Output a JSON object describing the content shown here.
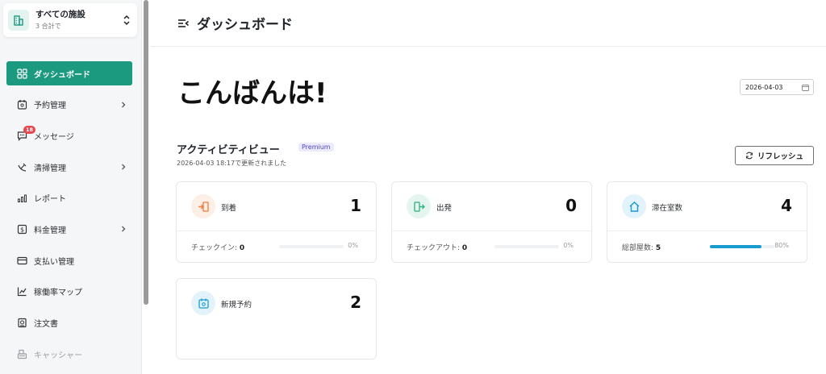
{
  "facility": {
    "title": "すべての施設",
    "subtitle": "3 合計で"
  },
  "nav": {
    "items": [
      {
        "label": "ダッシュボード"
      },
      {
        "label": "予約管理"
      },
      {
        "label": "メッセージ",
        "badge": "18"
      },
      {
        "label": "清掃管理"
      },
      {
        "label": "レポート"
      },
      {
        "label": "料金管理"
      },
      {
        "label": "支払い管理"
      },
      {
        "label": "稼働率マップ"
      },
      {
        "label": "注文書"
      },
      {
        "label": "キャッシャー"
      }
    ]
  },
  "header": {
    "title": "ダッシュボード"
  },
  "main": {
    "greeting": "こんばんは!",
    "date": "2026-04-03",
    "section_title": "アクティビティビュー",
    "premium": "Premium",
    "updated": "2026-04-03 18:17で更新されました",
    "refresh_label": "リフレッシュ"
  },
  "cards": [
    {
      "label": "到着",
      "value": "1",
      "foot_label": "チェックイン:",
      "foot_value": "0",
      "progress": 0,
      "percent": "0%"
    },
    {
      "label": "出発",
      "value": "0",
      "foot_label": "チェックアウト:",
      "foot_value": "0",
      "progress": 0,
      "percent": "0%"
    },
    {
      "label": "滞在室数",
      "value": "4",
      "foot_label": "総部屋数:",
      "foot_value": "5",
      "progress": 80,
      "percent": "80%"
    },
    {
      "label": "新規予約",
      "value": "2"
    }
  ],
  "colors": {
    "accent": "#1c9a80",
    "arrival_icon_bg": "#fdeee6",
    "arrival_icon": "#f07a3a",
    "departure_icon_bg": "#e3f5ee",
    "departure_icon": "#2bb07f",
    "stay_icon_bg": "#e3f3fb",
    "stay_icon": "#1a9bd0",
    "new_icon_bg": "#e3f3fb",
    "new_icon": "#1a9bd0",
    "progress": "#1a9bd0"
  }
}
